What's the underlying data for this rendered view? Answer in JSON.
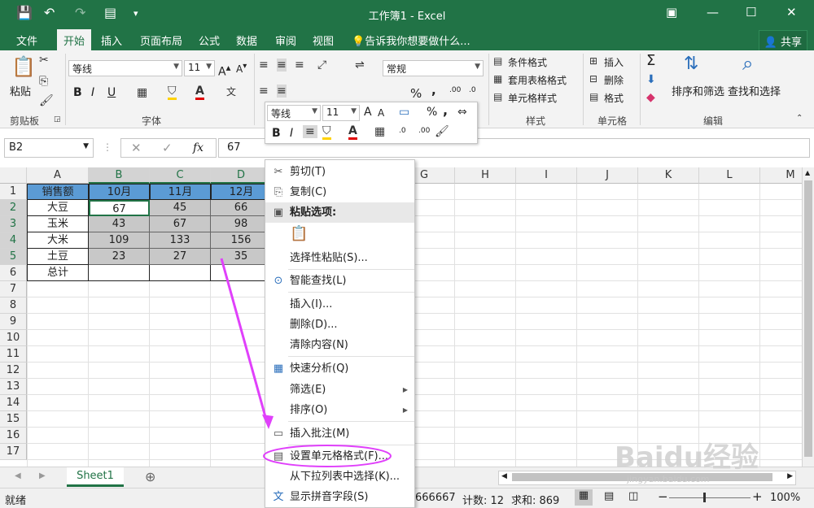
{
  "window": {
    "title": "工作簿1 - Excel"
  },
  "tabs": [
    "文件",
    "开始",
    "插入",
    "页面布局",
    "公式",
    "数据",
    "审阅",
    "视图"
  ],
  "tell_me": "告诉我你想要做什么...",
  "share": "共享",
  "ribbon": {
    "clipboard": {
      "paste": "粘贴",
      "group": "剪贴板"
    },
    "font": {
      "name": "等线",
      "size": "11",
      "group": "字体",
      "bold": "B",
      "italic": "I",
      "underline": "U"
    },
    "number": {
      "format": "常规",
      "percent": "%",
      "comma": ",",
      "inc_dec": ".00",
      "dec_dec": ".0"
    },
    "styles": {
      "cond_format": "条件格式",
      "table_format": "套用表格格式",
      "cell_styles": "单元格样式",
      "group": "样式"
    },
    "cells": {
      "insert": "插入",
      "delete": "删除",
      "format": "格式",
      "group": "单元格"
    },
    "editing": {
      "sort_filter": "排序和筛选",
      "find_select": "查找和选择",
      "group": "编辑",
      "sum": "Σ"
    }
  },
  "formula_bar": {
    "namebox": "B2",
    "value": "67",
    "fx": "fx"
  },
  "mini_toolbar": {
    "font": "等线",
    "size": "11",
    "percent": "%",
    "comma": ","
  },
  "columns": [
    "A",
    "B",
    "C",
    "D",
    "E",
    "F",
    "G",
    "H",
    "I",
    "J",
    "K",
    "L",
    "M"
  ],
  "rows": [
    "1",
    "2",
    "3",
    "4",
    "5",
    "6",
    "7",
    "8",
    "9",
    "10",
    "11",
    "12",
    "13",
    "14",
    "15",
    "16",
    "17"
  ],
  "table": {
    "header": [
      "销售额",
      "10月",
      "11月",
      "12月"
    ],
    "rows": [
      [
        "大豆",
        "67",
        "45",
        "66"
      ],
      [
        "玉米",
        "43",
        "67",
        "98"
      ],
      [
        "大米",
        "109",
        "133",
        "156"
      ],
      [
        "土豆",
        "23",
        "27",
        "35"
      ],
      [
        "总计",
        "",
        "",
        ""
      ]
    ]
  },
  "context_menu": [
    {
      "label": "剪切(T)",
      "icon": "cut-icon",
      "glyph": "✂"
    },
    {
      "label": "复制(C)",
      "icon": "copy-icon",
      "glyph": "⎘"
    },
    {
      "label": "粘贴选项:",
      "icon": "paste-icon",
      "glyph": "📋",
      "bold": true
    },
    {
      "label": "选择性粘贴(S)...",
      "icon": "",
      "glyph": ""
    },
    {
      "label": "智能查找(L)",
      "icon": "smart-lookup-icon",
      "glyph": "🔍"
    },
    {
      "label": "插入(I)...",
      "icon": "",
      "glyph": ""
    },
    {
      "label": "删除(D)...",
      "icon": "",
      "glyph": ""
    },
    {
      "label": "清除内容(N)",
      "icon": "",
      "glyph": ""
    },
    {
      "label": "快速分析(Q)",
      "icon": "quick-analysis-icon",
      "glyph": "▦"
    },
    {
      "label": "筛选(E)",
      "icon": "",
      "glyph": "",
      "submenu": true
    },
    {
      "label": "排序(O)",
      "icon": "",
      "glyph": "",
      "submenu": true
    },
    {
      "label": "插入批注(M)",
      "icon": "comment-icon",
      "glyph": "💬"
    },
    {
      "label": "设置单元格格式(F)...",
      "icon": "format-cells-icon",
      "glyph": "▤"
    },
    {
      "label": "从下拉列表中选择(K)...",
      "icon": "",
      "glyph": ""
    },
    {
      "label": "显示拼音字段(S)",
      "icon": "phonetic-icon",
      "glyph": "文"
    }
  ],
  "sheet_tab": "Sheet1",
  "status": {
    "ready": "就绪",
    "average": "666667",
    "count": "计数: 12",
    "sum": "求和: 869",
    "zoom": "100%"
  },
  "watermark": {
    "text": "Baidu经验",
    "url": "jingyan.baidu.com"
  },
  "colors": {
    "excel_green": "#217346",
    "header_blue": "#5b9bd5",
    "annotation_magenta": "#e040fb"
  }
}
